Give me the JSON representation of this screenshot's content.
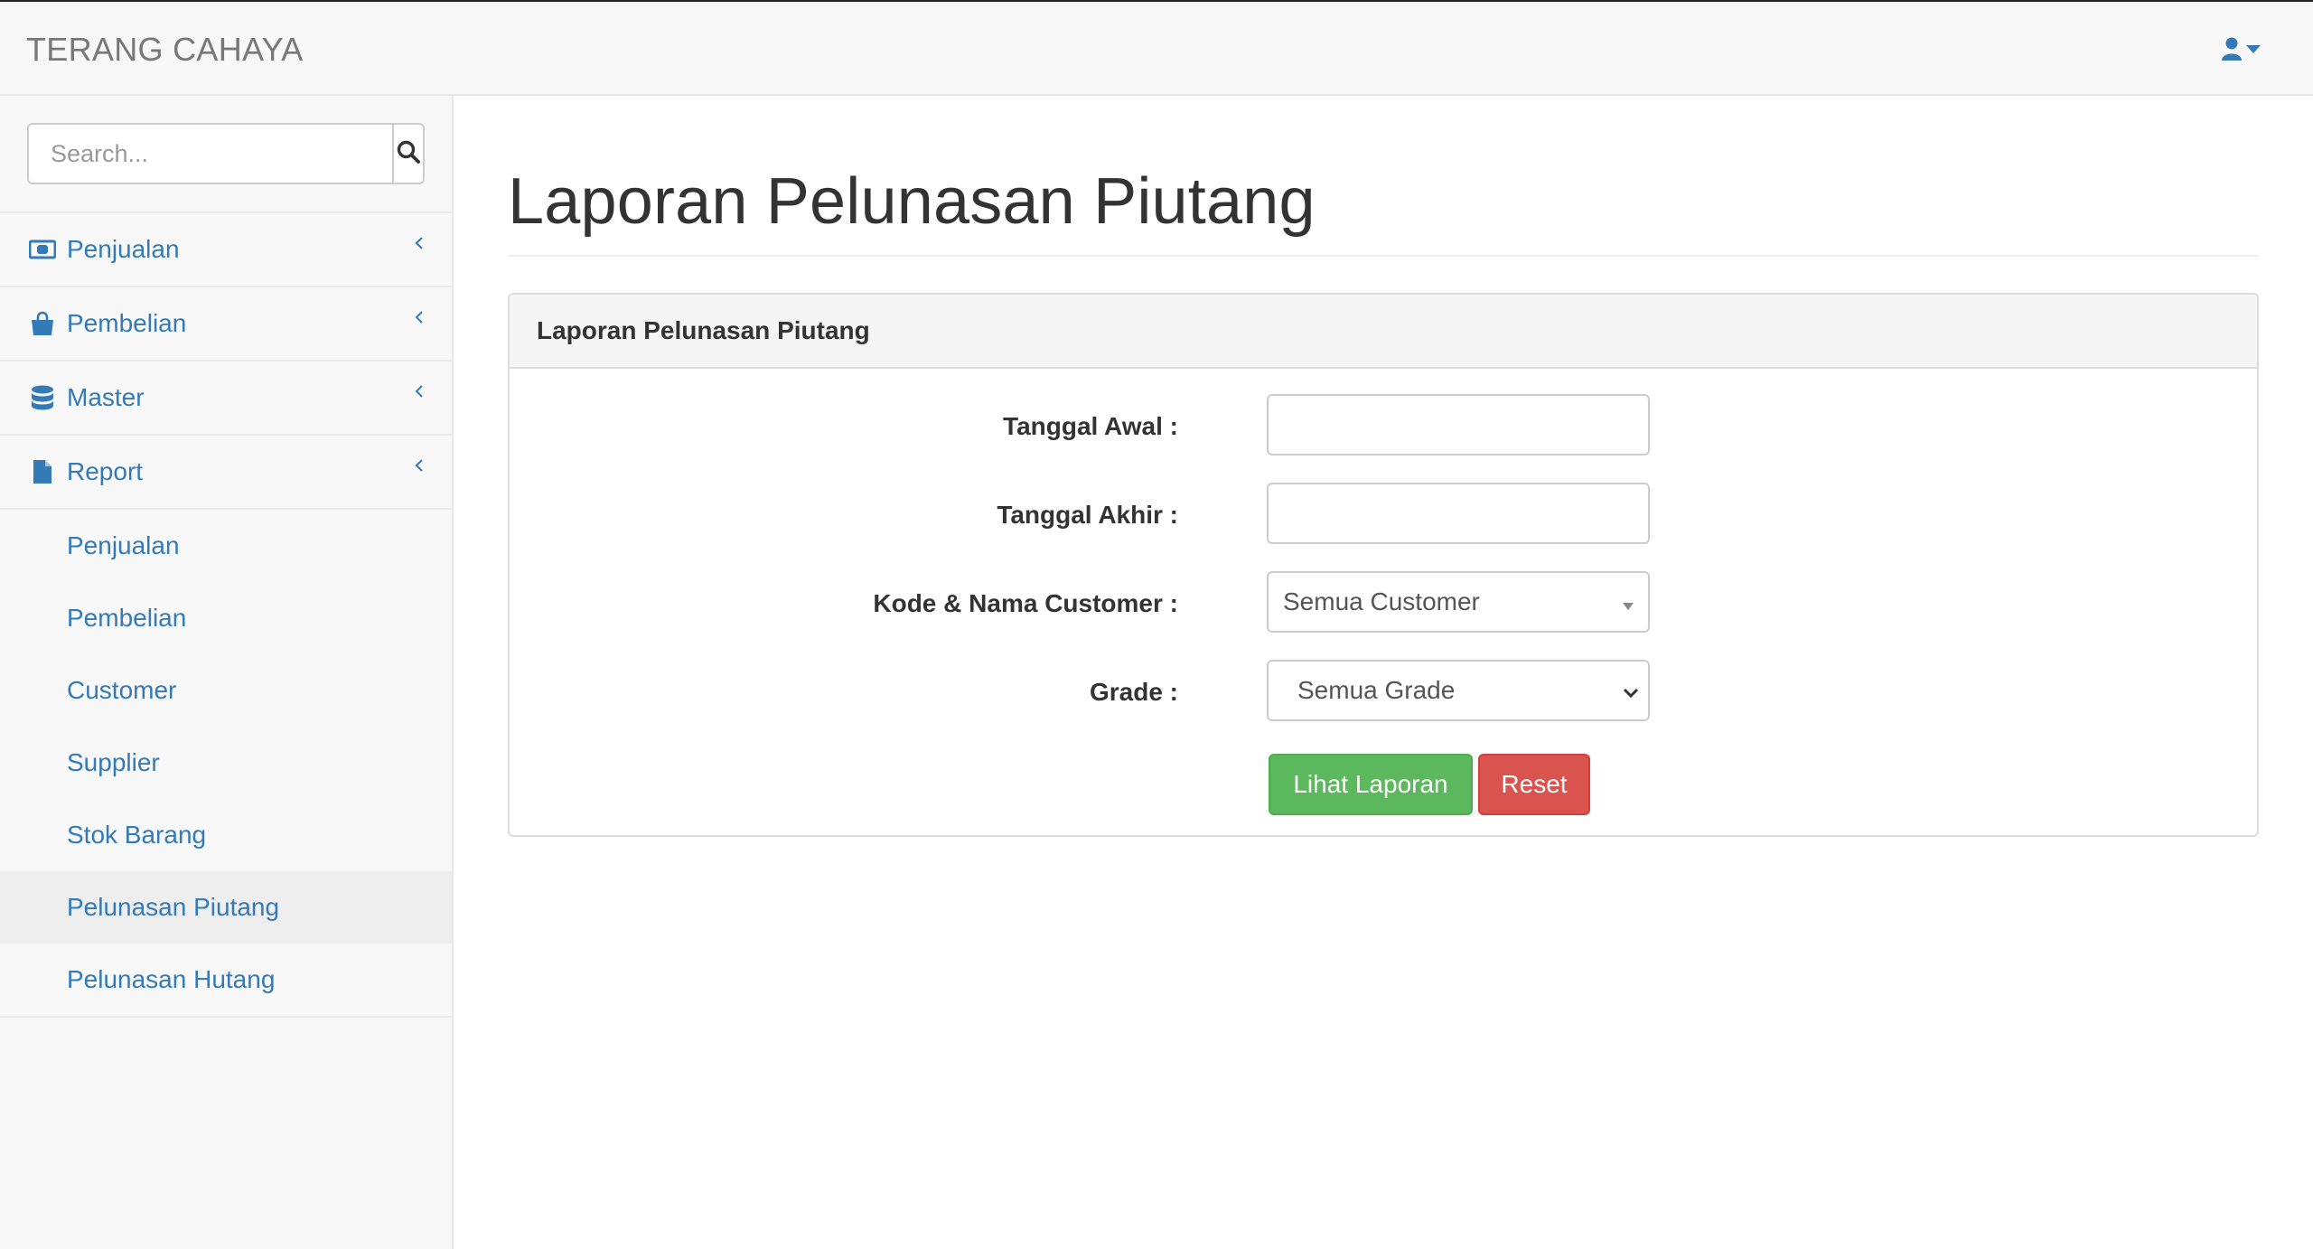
{
  "brand": "TERANG CAHAYA",
  "header": {
    "user_icon": "user-icon",
    "caret_icon": "caret-down-icon"
  },
  "colors": {
    "link": "#337ab7",
    "success": "#5cb85c",
    "danger": "#d9534f",
    "navbar_bg": "#f8f8f8"
  },
  "sidebar": {
    "search": {
      "placeholder": "Search...",
      "value": "",
      "icon": "search-icon"
    },
    "items": [
      {
        "label": "Penjualan",
        "icon": "money-icon"
      },
      {
        "label": "Pembelian",
        "icon": "shopping-bag-icon"
      },
      {
        "label": "Master",
        "icon": "database-icon"
      },
      {
        "label": "Report",
        "icon": "file-icon"
      }
    ],
    "report_sub": [
      {
        "label": "Penjualan"
      },
      {
        "label": "Pembelian"
      },
      {
        "label": "Customer"
      },
      {
        "label": "Supplier"
      },
      {
        "label": "Stok Barang"
      },
      {
        "label": "Pelunasan Piutang",
        "active": true
      },
      {
        "label": "Pelunasan Hutang"
      }
    ]
  },
  "main": {
    "title": "Laporan Pelunasan Piutang",
    "panel": {
      "heading": "Laporan Pelunasan Piutang",
      "fields": {
        "tanggal_awal": {
          "label": "Tanggal Awal :",
          "value": ""
        },
        "tanggal_akhir": {
          "label": "Tanggal Akhir :",
          "value": ""
        },
        "customer": {
          "label": "Kode & Nama Customer :",
          "selected": "Semua Customer"
        },
        "grade": {
          "label": "Grade :",
          "selected": "Semua Grade"
        }
      },
      "buttons": {
        "view": "Lihat Laporan",
        "reset": "Reset"
      }
    }
  }
}
